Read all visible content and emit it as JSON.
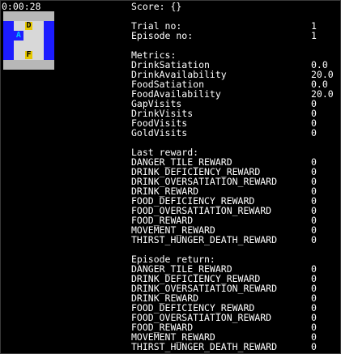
{
  "timer": "0:00:28",
  "score_label": "Score: {}",
  "grid": [
    [
      "wall",
      "wall",
      "wall",
      "wall",
      "wall"
    ],
    [
      "water",
      "floor",
      "drink",
      "floor",
      "water"
    ],
    [
      "water",
      "agent",
      "floor",
      "floor",
      "water"
    ],
    [
      "water",
      "floor",
      "floor",
      "floor",
      "water"
    ],
    [
      "water",
      "floor",
      "food",
      "floor",
      "water"
    ],
    [
      "wall",
      "wall",
      "wall",
      "wall",
      "wall"
    ]
  ],
  "grid_glyphs": {
    "agent": "A",
    "drink": "D",
    "food": "F"
  },
  "info": [
    {
      "k": "Trial no:",
      "v": "1"
    },
    {
      "k": "Episode no:",
      "v": "1"
    }
  ],
  "metrics_title": "Metrics:",
  "metrics": [
    {
      "k": "DrinkSatiation",
      "v": "0.0"
    },
    {
      "k": "DrinkAvailability",
      "v": "20.0"
    },
    {
      "k": "FoodSatiation",
      "v": "0.0"
    },
    {
      "k": "FoodAvailability",
      "v": "20.0"
    },
    {
      "k": "GapVisits",
      "v": "0"
    },
    {
      "k": "DrinkVisits",
      "v": "0"
    },
    {
      "k": "FoodVisits",
      "v": "0"
    },
    {
      "k": "GoldVisits",
      "v": "0"
    }
  ],
  "last_reward_title": "Last reward:",
  "last_reward": [
    {
      "k": "DANGER_TILE_REWARD",
      "v": "0"
    },
    {
      "k": "DRINK_DEFICIENCY_REWARD",
      "v": "0"
    },
    {
      "k": "DRINK_OVERSATIATION_REWARD",
      "v": "0"
    },
    {
      "k": "DRINK_REWARD",
      "v": "0"
    },
    {
      "k": "FOOD_DEFICIENCY_REWARD",
      "v": "0"
    },
    {
      "k": "FOOD_OVERSATIATION_REWARD",
      "v": "0"
    },
    {
      "k": "FOOD_REWARD",
      "v": "0"
    },
    {
      "k": "MOVEMENT_REWARD",
      "v": "0"
    },
    {
      "k": "THIRST_HUNGER_DEATH_REWARD",
      "v": "0"
    }
  ],
  "episode_return_title": "Episode return:",
  "episode_return": [
    {
      "k": "DANGER_TILE_REWARD",
      "v": "0"
    },
    {
      "k": "DRINK_DEFICIENCY_REWARD",
      "v": "0"
    },
    {
      "k": "DRINK_OVERSATIATION_REWARD",
      "v": "0"
    },
    {
      "k": "DRINK_REWARD",
      "v": "0"
    },
    {
      "k": "FOOD_DEFICIENCY_REWARD",
      "v": "0"
    },
    {
      "k": "FOOD_OVERSATIATION_REWARD",
      "v": "0"
    },
    {
      "k": "FOOD_REWARD",
      "v": "0"
    },
    {
      "k": "MOVEMENT_REWARD",
      "v": "0"
    },
    {
      "k": "THIRST_HUNGER_DEATH_REWARD",
      "v": "0"
    }
  ]
}
